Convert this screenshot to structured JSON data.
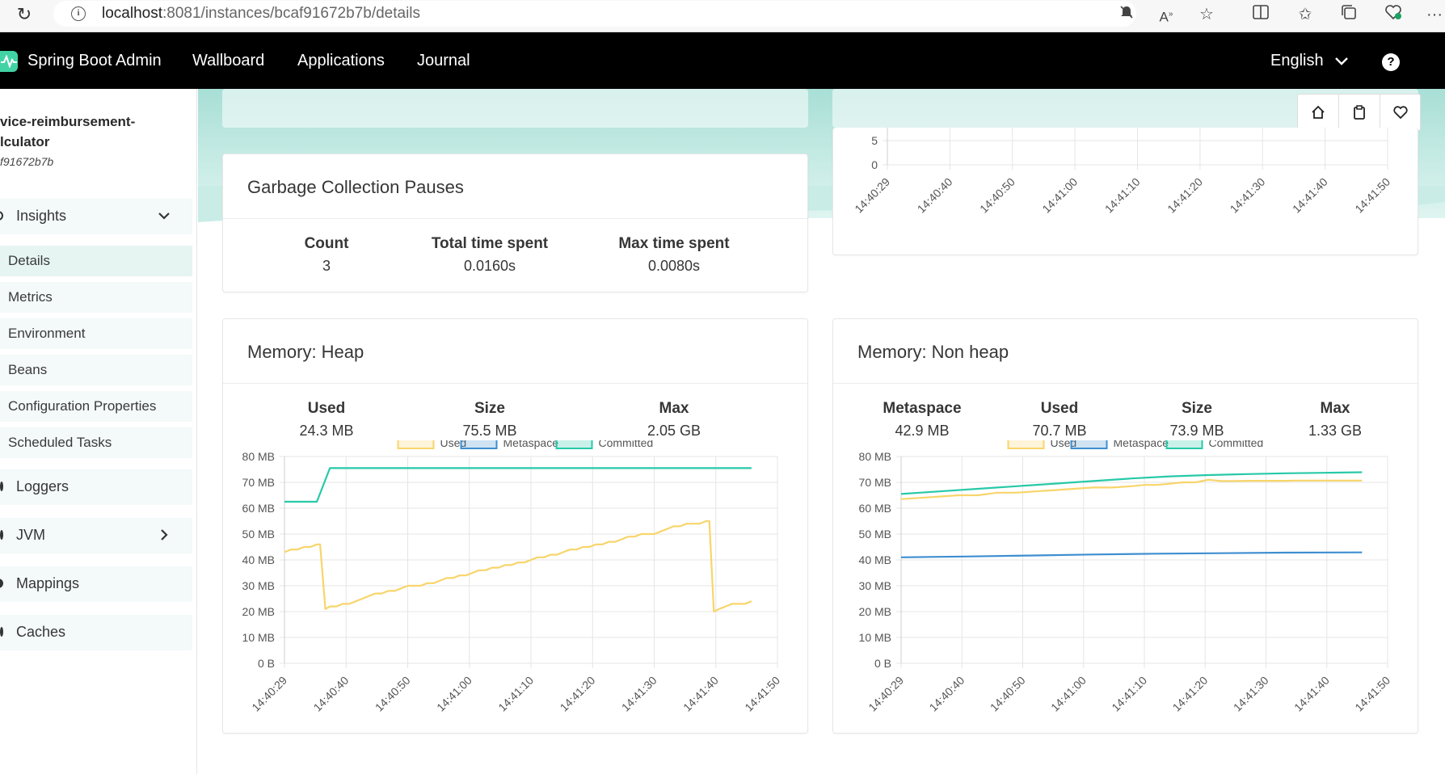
{
  "browser": {
    "url_host": "localhost",
    "url_rest": ":8081/instances/bcaf91672b7b/details"
  },
  "navbar": {
    "brand": "Spring Boot Admin",
    "items": [
      "Wallboard",
      "Applications",
      "Journal"
    ],
    "language": "English",
    "help": "?"
  },
  "sidebar": {
    "app_name_line1": "vice-reimbursement-",
    "app_name_line2": "lculator",
    "instance_id": "f91672b7b",
    "insights": "Insights",
    "insights_items": [
      "Details",
      "Metrics",
      "Environment",
      "Beans",
      "Configuration Properties",
      "Scheduled Tasks"
    ],
    "loggers": "Loggers",
    "jvm": "JVM",
    "mappings": "Mappings",
    "caches": "Caches"
  },
  "gc": {
    "title": "Garbage Collection Pauses",
    "count_label": "Count",
    "count_value": "3",
    "total_label": "Total time spent",
    "total_value": "0.0160s",
    "max_label": "Max time spent",
    "max_value": "0.0080s"
  },
  "heap": {
    "title": "Memory: Heap",
    "used_label": "Used",
    "used_value": "24.3 MB",
    "size_label": "Size",
    "size_value": "75.5 MB",
    "max_label": "Max",
    "max_value": "2.05 GB"
  },
  "nonheap": {
    "title": "Memory: Non heap",
    "metaspace_label": "Metaspace",
    "metaspace_value": "42.9 MB",
    "used_label": "Used",
    "used_value": "70.7 MB",
    "size_label": "Size",
    "size_value": "73.9 MB",
    "max_label": "Max",
    "max_value": "1.33 GB"
  },
  "colors": {
    "used": "#f8d56b",
    "metaspace": "#3e8ed0",
    "committed": "#27c9a8"
  },
  "chart_data": [
    {
      "type": "line",
      "title": "Memory: Heap",
      "x_ticks": [
        "14:40:29",
        "14:40:40",
        "14:40:50",
        "14:41:00",
        "14:41:10",
        "14:41:20",
        "14:41:30",
        "14:41:40",
        "14:41:50"
      ],
      "y_ticks": [
        "0 B",
        "10 MB",
        "20 MB",
        "30 MB",
        "40 MB",
        "50 MB",
        "60 MB",
        "70 MB",
        "80 MB"
      ],
      "ylim": [
        0,
        80
      ],
      "legend": [
        "Used",
        "Metaspace",
        "Committed"
      ],
      "series": [
        {
          "name": "Committed",
          "color": "#27c9a8",
          "x": [
            0,
            5,
            7,
            72
          ],
          "y": [
            62.5,
            62.5,
            75.5,
            75.5
          ]
        },
        {
          "name": "Used",
          "color": "#f8d56b",
          "x": [
            0,
            1,
            2,
            3,
            4,
            5,
            5.5,
            6.3,
            7,
            8,
            9,
            10,
            11,
            12,
            13,
            14,
            15,
            16,
            17,
            18,
            19,
            20,
            21,
            22,
            23,
            24,
            25,
            26,
            27,
            28,
            29,
            30,
            31,
            32,
            33,
            34,
            35,
            36,
            37,
            38,
            39,
            40,
            41,
            42,
            43,
            44,
            45,
            46,
            47,
            48,
            49,
            50,
            51,
            52,
            53,
            54,
            55,
            56,
            57,
            58,
            59,
            60,
            61,
            62,
            63,
            64,
            65,
            65.5,
            66.2,
            67,
            68,
            69,
            70,
            71,
            72
          ],
          "y": [
            43,
            44,
            44,
            45,
            45,
            46,
            46,
            21,
            22,
            22,
            23,
            23,
            24,
            25,
            26,
            27,
            27,
            28,
            28,
            29,
            30,
            30,
            30,
            31,
            31,
            32,
            33,
            33,
            34,
            34,
            35,
            36,
            36,
            37,
            37,
            38,
            38,
            39,
            39,
            40,
            41,
            41,
            42,
            42,
            43,
            44,
            44,
            45,
            45,
            46,
            46,
            47,
            47,
            48,
            49,
            49,
            50,
            50,
            50,
            51,
            52,
            53,
            53,
            54,
            54,
            54,
            55,
            55,
            20,
            21,
            22,
            23,
            23,
            23,
            24
          ]
        }
      ]
    },
    {
      "type": "line",
      "title": "Memory: Non heap",
      "x_ticks": [
        "14:40:29",
        "14:40:40",
        "14:40:50",
        "14:41:00",
        "14:41:10",
        "14:41:20",
        "14:41:30",
        "14:41:40",
        "14:41:50"
      ],
      "y_ticks": [
        "0 B",
        "10 MB",
        "20 MB",
        "30 MB",
        "40 MB",
        "50 MB",
        "60 MB",
        "70 MB",
        "80 MB"
      ],
      "ylim": [
        0,
        80
      ],
      "legend": [
        "Used",
        "Metaspace",
        "Committed"
      ],
      "series": [
        {
          "name": "Committed",
          "color": "#27c9a8",
          "x": [
            0,
            6,
            12,
            18,
            24,
            30,
            36,
            42,
            48,
            54,
            60,
            66,
            72
          ],
          "y": [
            65.5,
            66.5,
            67.5,
            68.5,
            69.5,
            70.5,
            71.5,
            72.3,
            72.8,
            73.2,
            73.5,
            73.7,
            73.9
          ]
        },
        {
          "name": "Used",
          "color": "#f8d56b",
          "x": [
            0,
            3,
            6,
            9,
            12,
            15,
            18,
            21,
            24,
            27,
            30,
            33,
            36,
            38,
            40,
            42,
            44,
            46,
            48,
            50,
            52,
            54,
            56,
            58,
            60,
            62,
            64,
            66,
            68,
            70,
            72
          ],
          "y": [
            63.5,
            64,
            64.5,
            65,
            65,
            66,
            66,
            66.5,
            67,
            67.5,
            68,
            68,
            68.5,
            69,
            69,
            69.5,
            70,
            70,
            71,
            70.5,
            70.5,
            70.6,
            70.6,
            70.6,
            70.6,
            70.7,
            70.7,
            70.7,
            70.7,
            70.7,
            70.7
          ]
        },
        {
          "name": "Metaspace",
          "color": "#3e8ed0",
          "x": [
            0,
            10,
            20,
            30,
            40,
            50,
            60,
            72
          ],
          "y": [
            41,
            41.3,
            41.7,
            42.1,
            42.4,
            42.6,
            42.8,
            42.9
          ]
        }
      ]
    },
    {
      "type": "line",
      "title": "",
      "x_ticks": [
        "14:40:29",
        "14:40:40",
        "14:40:50",
        "14:41:00",
        "14:41:10",
        "14:41:20",
        "14:41:30",
        "14:41:40",
        "14:41:50"
      ],
      "y_ticks": [
        "0",
        "5"
      ],
      "ylim": [
        0,
        5
      ],
      "series": []
    }
  ]
}
